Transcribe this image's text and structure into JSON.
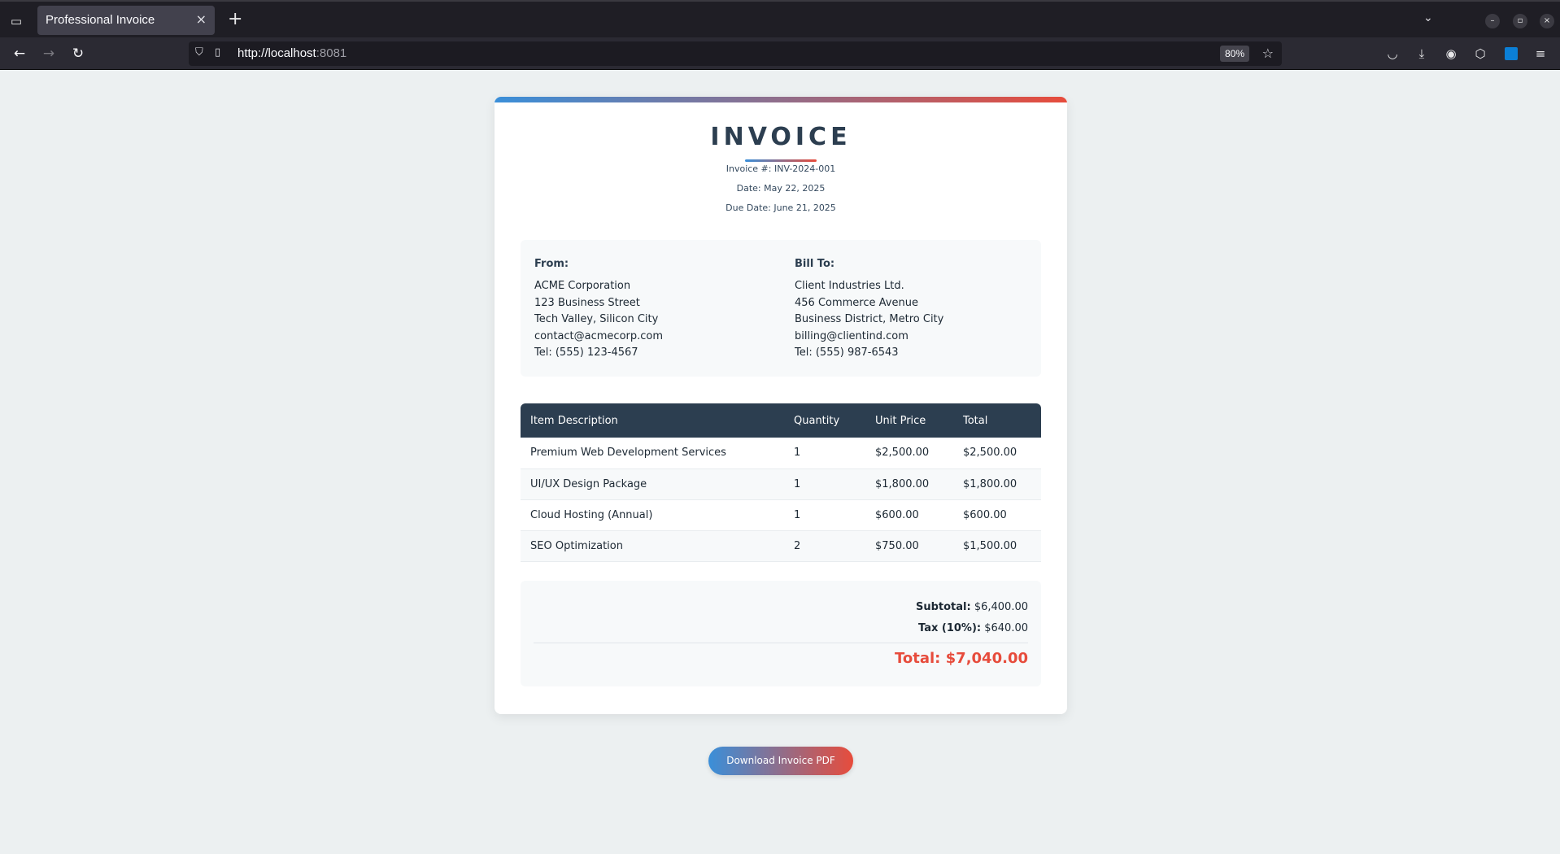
{
  "browser": {
    "tab_title": "Professional Invoice",
    "url_host": "http://localhost",
    "url_port": ":8081",
    "zoom": "80%"
  },
  "icons": {
    "tab_list": "▭",
    "tab_close": "×",
    "new_tab": "+",
    "tab_overflow": "⌄",
    "minimize": "–",
    "restore": "▫",
    "close_window": "×",
    "back": "←",
    "forward": "→",
    "reload": "↻",
    "shield": "⛉",
    "page": "▯",
    "star": "☆",
    "pocket": "◡",
    "download": "⤓",
    "account": "◉",
    "extensions": "⬡",
    "menu": "≡"
  },
  "invoice": {
    "title": "INVOICE",
    "number": "Invoice #: INV-2024-001",
    "date": "Date: May 22, 2025",
    "due_date": "Due Date: June 21, 2025",
    "from": {
      "heading": "From:",
      "lines": [
        "ACME Corporation",
        "123 Business Street",
        "Tech Valley, Silicon City",
        "contact@acmecorp.com",
        "Tel: (555) 123-4567"
      ]
    },
    "bill_to": {
      "heading": "Bill To:",
      "lines": [
        "Client Industries Ltd.",
        "456 Commerce Avenue",
        "Business District, Metro City",
        "billing@clientind.com",
        "Tel: (555) 987-6543"
      ]
    },
    "table": {
      "headers": [
        "Item Description",
        "Quantity",
        "Unit Price",
        "Total"
      ],
      "rows": [
        [
          "Premium Web Development Services",
          "1",
          "$2,500.00",
          "$2,500.00"
        ],
        [
          "UI/UX Design Package",
          "1",
          "$1,800.00",
          "$1,800.00"
        ],
        [
          "Cloud Hosting (Annual)",
          "1",
          "$600.00",
          "$600.00"
        ],
        [
          "SEO Optimization",
          "2",
          "$750.00",
          "$1,500.00"
        ]
      ]
    },
    "totals": {
      "subtotal_label": "Subtotal:",
      "subtotal_value": "$6,400.00",
      "tax_label": "Tax (10%):",
      "tax_value": "$640.00",
      "total": "Total: $7,040.00"
    }
  },
  "download_label": "Download Invoice PDF",
  "colors": {
    "accent_blue": "#3a8fd9",
    "accent_red": "#e74c3c",
    "table_header": "#2c3e50",
    "page_bg": "#ecf0f1"
  }
}
